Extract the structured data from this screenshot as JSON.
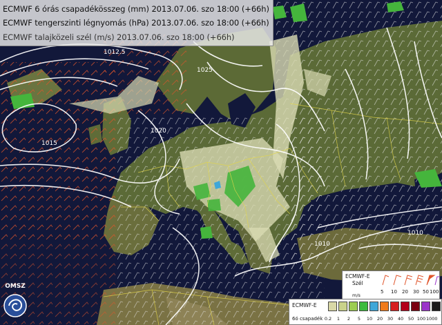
{
  "titles": {
    "line1": "ECMWF 6 órás csapadékösszeg (mm) 2013.07.06. szo 18:00 (+66h)",
    "line2": "ECMWF tengerszinti légnyomás (hPa) 2013.07.06. szo 18:00 (+66h)",
    "line3": "ECMWF talajközeli szél (m/s) 2013.07.06. szo 18:00 (+66h)"
  },
  "logo": {
    "text": "OMSZ",
    "icon": "omsz-logo-icon"
  },
  "isobar_labels": [
    "1012.5",
    "1025",
    "1020",
    "1010",
    "1015",
    "1010"
  ],
  "wind_legend": {
    "title": "ECMWF-E",
    "subtitle": "Szél",
    "unit": "m/s",
    "values": [
      "5",
      "10",
      "20",
      "30",
      "50",
      "100"
    ]
  },
  "precip_legend": {
    "title": "ECMWF-E",
    "subtitle": "6ó csapadék",
    "values": [
      "0.2",
      "1",
      "2",
      "5",
      "10",
      "20",
      "30",
      "40",
      "50",
      "100",
      "1000"
    ],
    "colors": [
      "#d9d8a6",
      "#c9d28a",
      "#9ccc52",
      "#3dbb3d",
      "#3fa7d8",
      "#f07b1c",
      "#d61e1e",
      "#b3001a",
      "#7a0010",
      "#9b35c9",
      "#1a1a1a"
    ]
  },
  "colors": {
    "sea": "#12183a",
    "land": "#5f6a3a",
    "isobar": "#ffffff",
    "wind_barb_warm": "#e0542a",
    "wind_barb_cool": "#e8e8e8",
    "borders": "#e3d64a",
    "precip_light": "#dadbb3",
    "precip_green": "#45b53c"
  }
}
